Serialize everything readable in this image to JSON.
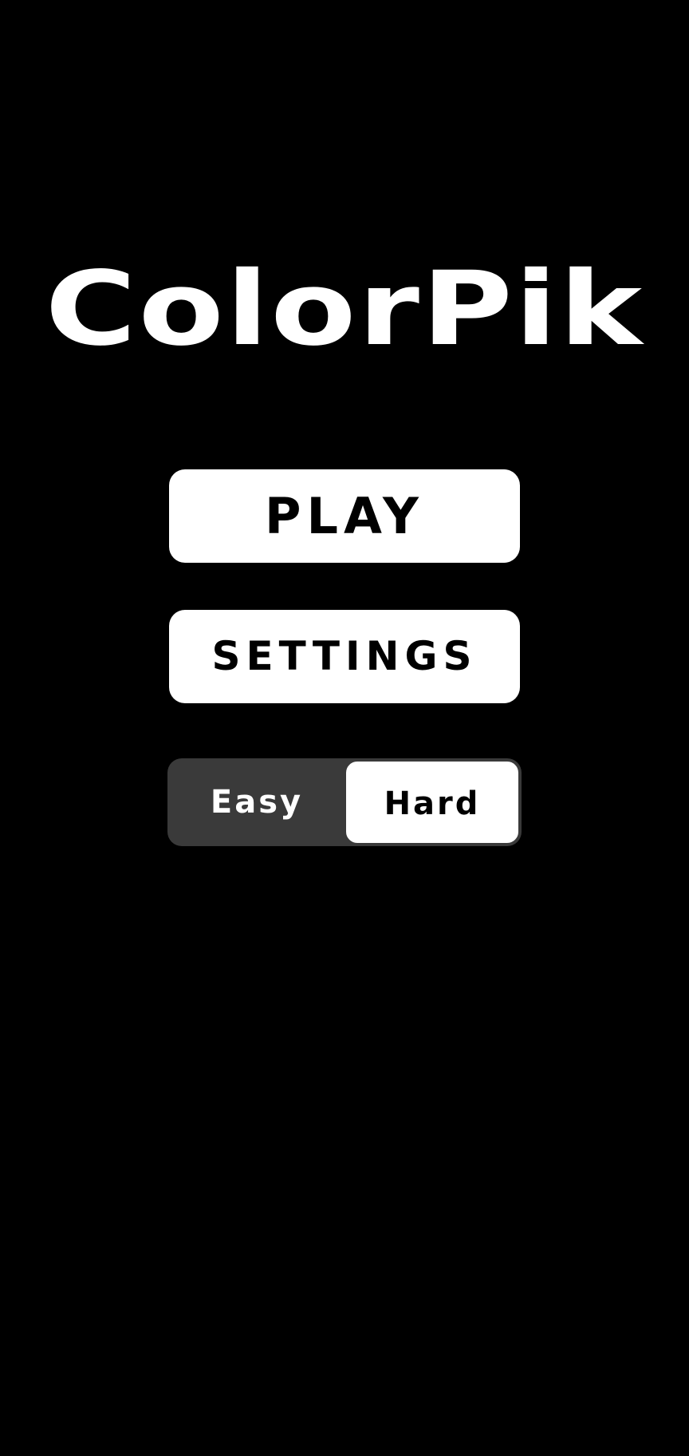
{
  "app": {
    "title": "ColorPik"
  },
  "menu": {
    "play_label": "PLAY",
    "settings_label": "SETTINGS"
  },
  "difficulty": {
    "options": [
      {
        "label": "Easy",
        "selected": false
      },
      {
        "label": "Hard",
        "selected": true
      }
    ],
    "selected_value": "Hard"
  },
  "colors": {
    "background": "#000000",
    "button_fill": "#ffffff",
    "button_text": "#000000",
    "toggle_track": "#3a3a3a"
  }
}
